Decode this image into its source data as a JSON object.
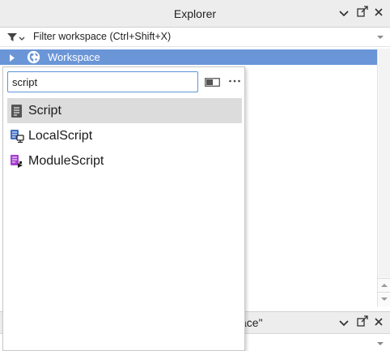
{
  "explorer": {
    "title": "Explorer",
    "filter_placeholder": "Filter workspace (Ctrl+Shift+X)",
    "tree": [
      {
        "label": "Workspace",
        "icon": "globe-icon",
        "selected": true,
        "expanded": false
      }
    ]
  },
  "insert_popup": {
    "search_value": "script",
    "results": [
      {
        "label": "Script",
        "icon": "script-icon",
        "selected": true
      },
      {
        "label": "LocalScript",
        "icon": "local-script-icon",
        "selected": false
      },
      {
        "label": "ModuleScript",
        "icon": "module-script-icon",
        "selected": false
      }
    ]
  },
  "second_panel": {
    "title_fragment": "ace\""
  },
  "colors": {
    "selection": "#6a96d8",
    "titlebar": "#ededed",
    "input_focus": "#5b95d6",
    "result_selected": "#dcdcdc"
  }
}
